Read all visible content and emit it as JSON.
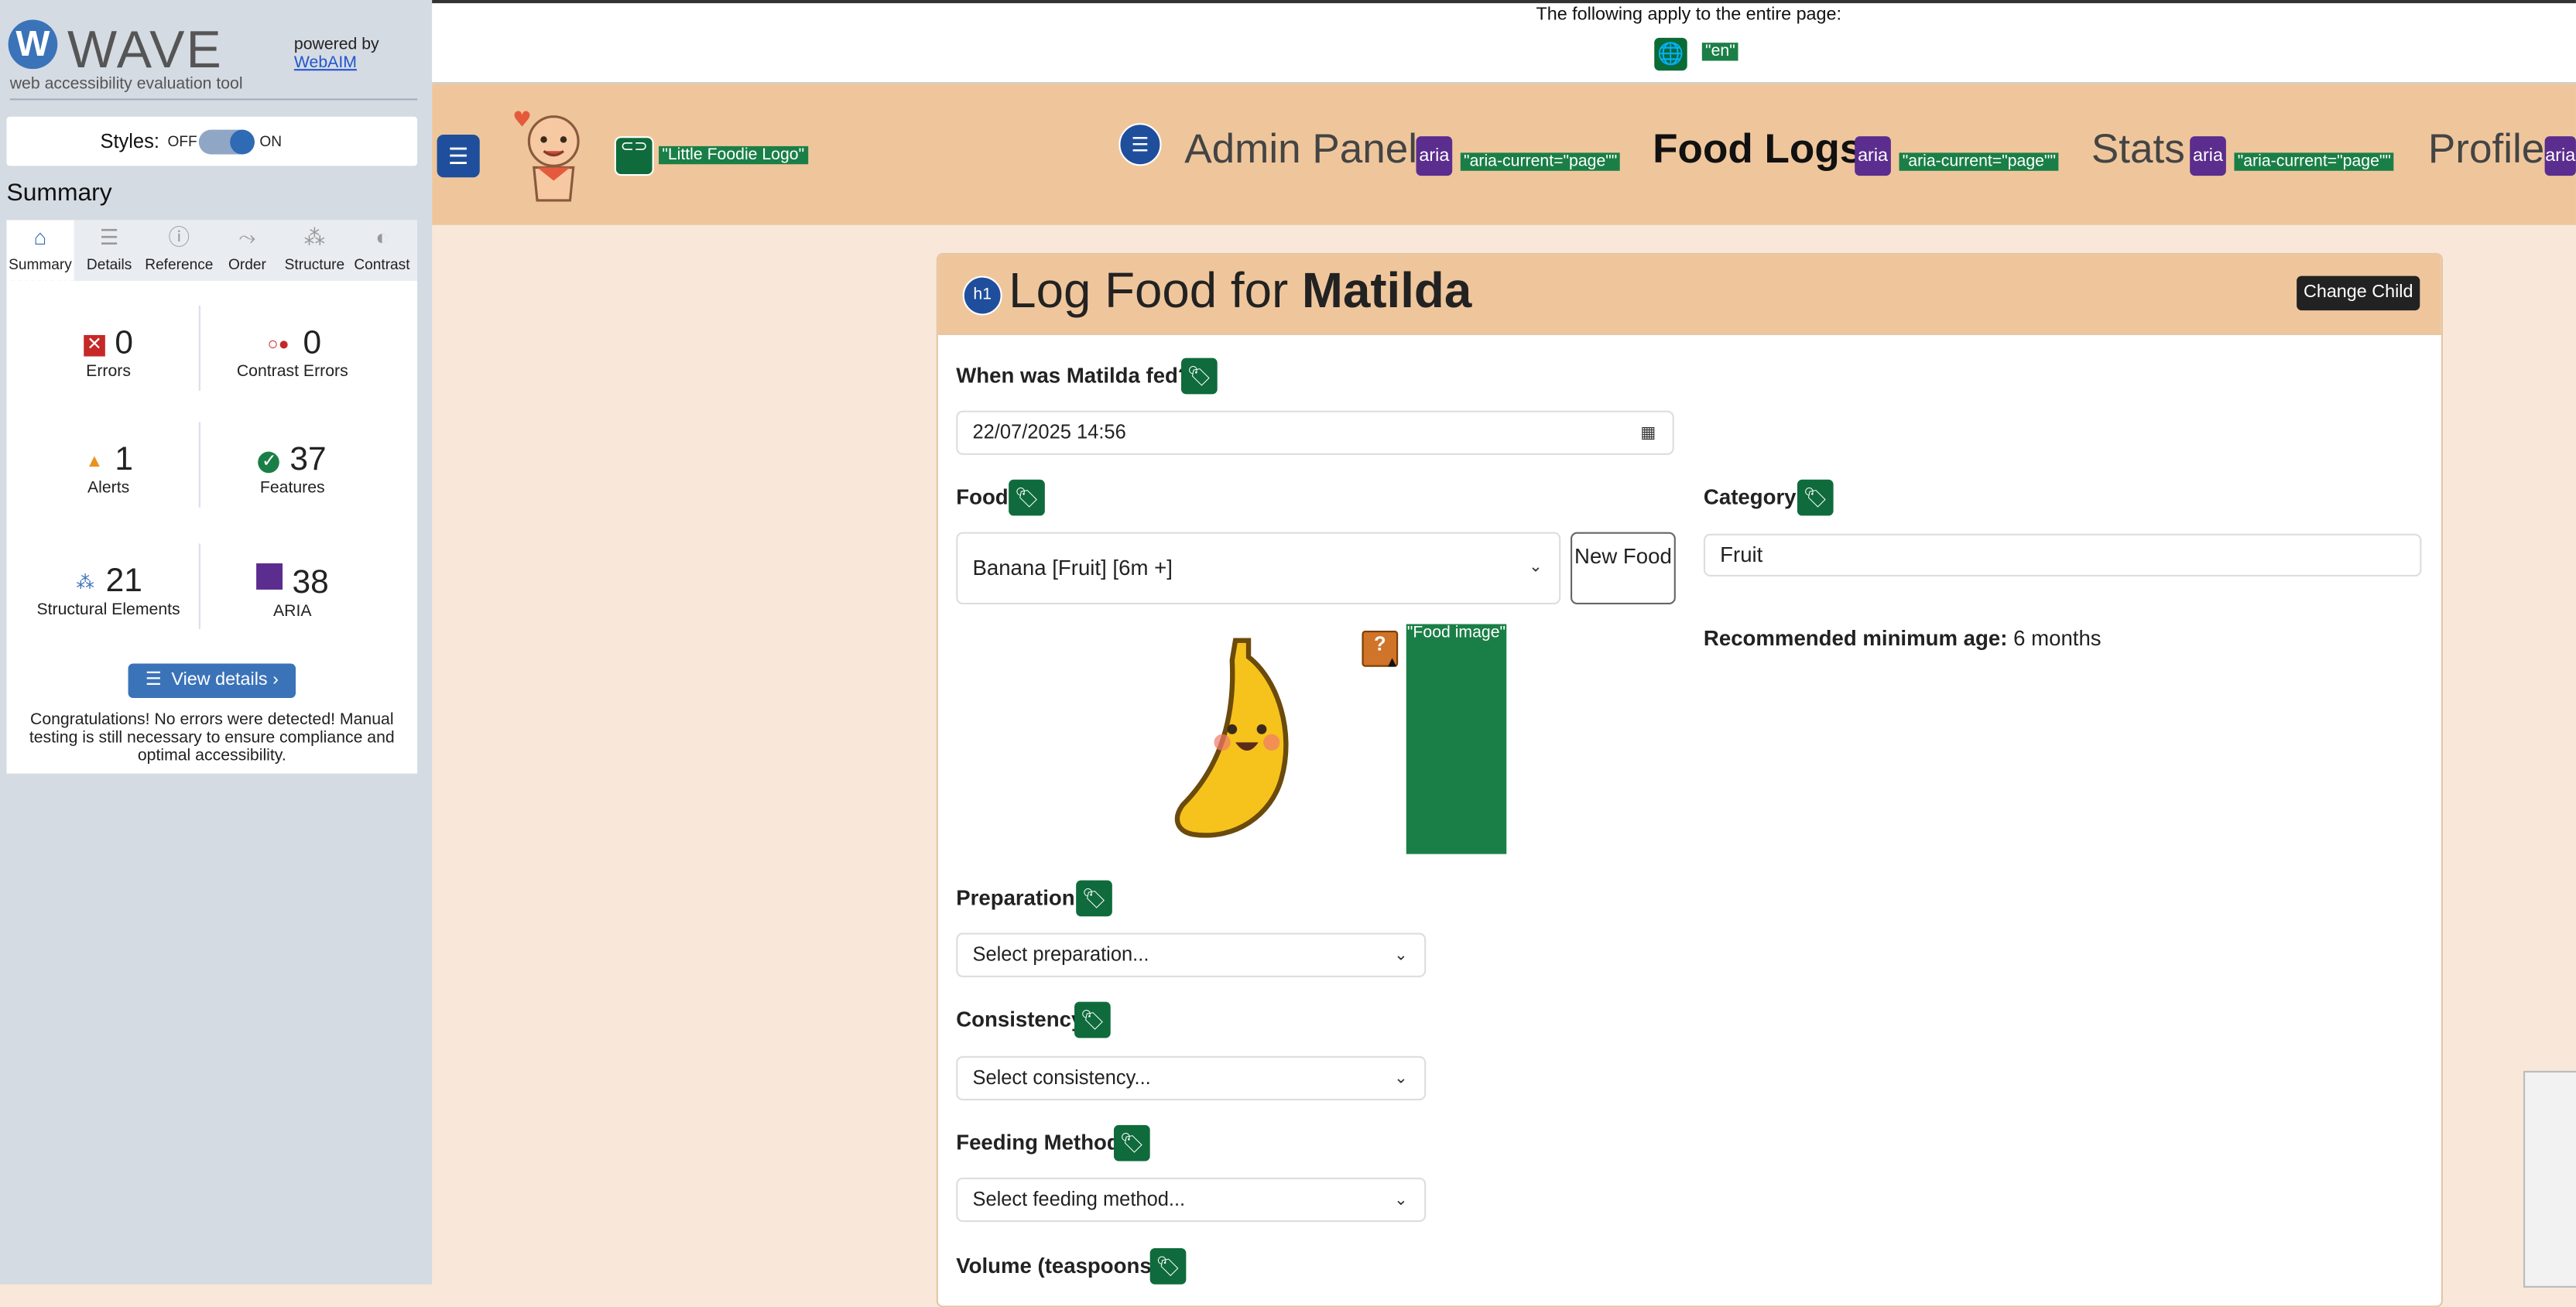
{
  "wave": {
    "logo_letter": "W",
    "title": "WAVE",
    "subtitle": "web accessibility evaluation tool",
    "powered_by": "powered by",
    "webaim_link": "WebAIM",
    "styles_label": "Styles:",
    "styles_off": "OFF",
    "styles_on": "ON",
    "summary_heading": "Summary",
    "tabs": [
      {
        "label": "Summary",
        "icon": "home-icon"
      },
      {
        "label": "Details",
        "icon": "list-icon"
      },
      {
        "label": "Reference",
        "icon": "info-icon"
      },
      {
        "label": "Order",
        "icon": "order-icon"
      },
      {
        "label": "Structure",
        "icon": "structure-icon"
      },
      {
        "label": "Contrast",
        "icon": "contrast-icon"
      }
    ],
    "stats": {
      "errors": {
        "count": "0",
        "label": "Errors"
      },
      "contrast": {
        "count": "0",
        "label": "Contrast Errors"
      },
      "alerts": {
        "count": "1",
        "label": "Alerts"
      },
      "features": {
        "count": "37",
        "label": "Features"
      },
      "structural": {
        "count": "21",
        "label": "Structural Elements"
      },
      "aria": {
        "count": "38",
        "label": "ARIA"
      }
    },
    "view_details": "View details ›",
    "congrats": "Congratulations! No errors were detected! Manual testing is still necessary to ensure compliance and optimal accessibility."
  },
  "page_notice": {
    "text": "The following apply to the entire page:",
    "lang": "\"en\""
  },
  "nav": {
    "logo_tag": "\"Little Foodie Logo\"",
    "links": [
      {
        "label": "Admin Panel",
        "aria": "\"aria-current=\"page\"\""
      },
      {
        "label": "Food Logs",
        "aria": "\"aria-current=\"page\"\""
      },
      {
        "label": "Stats",
        "aria": "\"aria-current=\"page\"\""
      },
      {
        "label": "Profile",
        "aria": ""
      }
    ],
    "aria_icon_text": "aria"
  },
  "form": {
    "title_prefix": "Log Food for ",
    "title_name": "Matilda",
    "h1_badge": "h1",
    "change_child": "Change Child",
    "when_label": "When was Matilda fed?",
    "when_value": "22/07/2025 14:56",
    "food_label": "Food",
    "food_value": "Banana [Fruit] [6m +]",
    "new_food": "New Food",
    "category_label": "Category",
    "category_value": "Fruit",
    "min_age_label": "Recommended minimum age:",
    "min_age_value": " 6 months",
    "food_image_tag": "\"Food image\"",
    "alert_icon": "?",
    "preparation_label": "Preparation",
    "preparation_value": "Select preparation...",
    "consistency_label": "Consistency",
    "consistency_value": "Select consistency...",
    "feeding_label": "Feeding Method",
    "feeding_value": "Select feeding method...",
    "volume_label": "Volume (teaspoons)"
  },
  "colors": {
    "nav_bg": "#efc69c",
    "page_bg": "#f9e8d9",
    "wave_blue": "#3b73b9",
    "feature_green": "#1a7f46",
    "aria_purple": "#5b2d8e"
  }
}
